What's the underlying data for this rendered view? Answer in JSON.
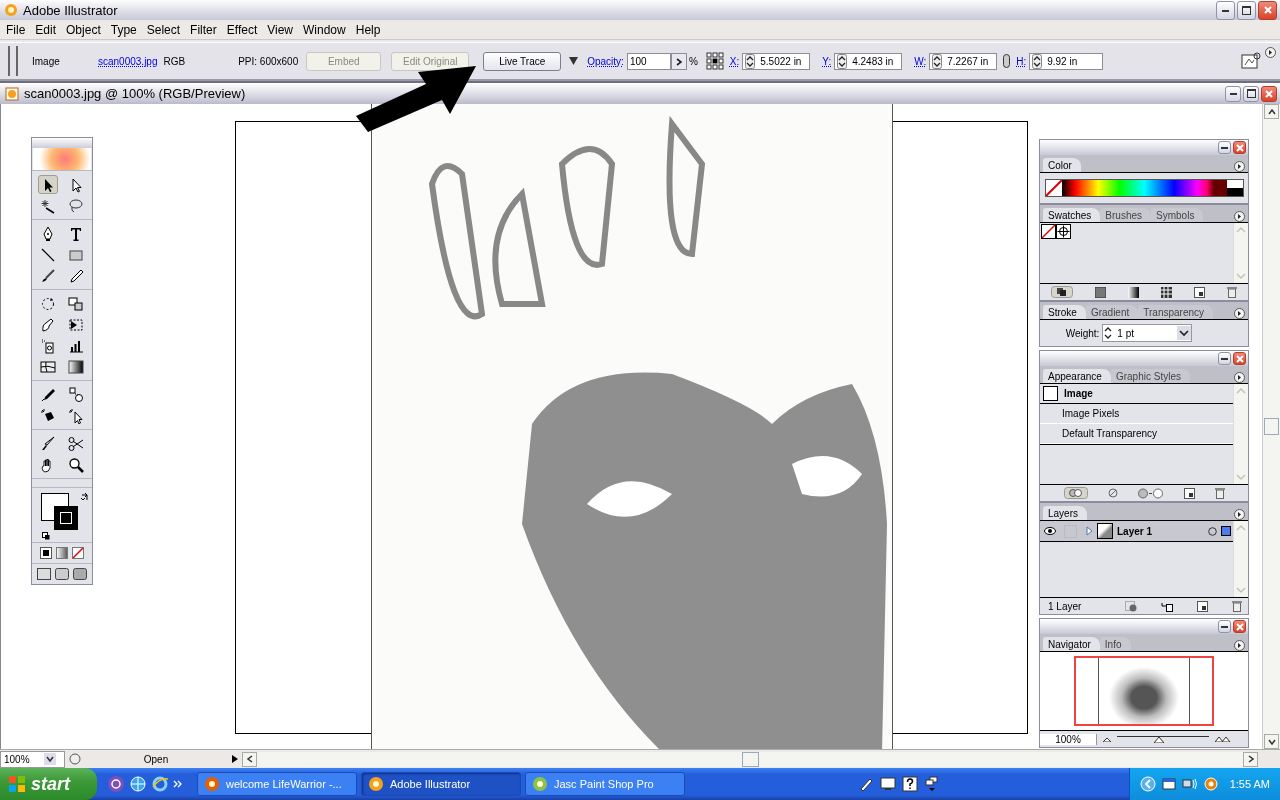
{
  "window": {
    "title": "Adobe Illustrator"
  },
  "menu": [
    "File",
    "Edit",
    "Object",
    "Type",
    "Select",
    "Filter",
    "Effect",
    "View",
    "Window",
    "Help"
  ],
  "control_bar": {
    "object_type": "Image",
    "file_link": "scan0003.jpg",
    "color_mode": "RGB",
    "ppi": "PPI: 600x600",
    "buttons": [
      {
        "label": "Embed",
        "disabled": true
      },
      {
        "label": "Edit Original",
        "disabled": true
      },
      {
        "label": "Live Trace",
        "disabled": false
      }
    ],
    "opacity_label": "Opacity:",
    "opacity": "100",
    "percent": "%",
    "fields": [
      {
        "label": "X:",
        "value": "5.5022 in"
      },
      {
        "label": "Y:",
        "value": "4.2483 in"
      },
      {
        "label": "W:",
        "value": "7.2267 in"
      },
      {
        "label": "H:",
        "value": "9.92 in"
      }
    ]
  },
  "document": {
    "title": "scan0003.jpg @ 100% (RGB/Preview)"
  },
  "toolbox": {
    "tools": [
      {
        "selected": true
      },
      {
        "selected": false
      },
      {
        "selected": false
      },
      {
        "selected": false
      },
      {
        "selected": false
      },
      {
        "selected": false
      },
      {
        "selected": false
      },
      {
        "selected": false
      },
      {
        "selected": false
      },
      {
        "selected": false
      },
      {
        "selected": false
      },
      {
        "selected": false
      },
      {
        "selected": false
      },
      {
        "selected": false
      },
      {
        "selected": false
      },
      {
        "selected": false
      },
      {
        "selected": false
      },
      {
        "selected": false
      },
      {
        "selected": false
      },
      {
        "selected": false
      },
      {
        "selected": false
      },
      {
        "selected": false
      },
      {
        "selected": false
      },
      {
        "selected": false
      },
      {
        "selected": false
      },
      {
        "selected": false
      }
    ]
  },
  "color_panel": {
    "tabs": [
      {
        "label": "Color",
        "selected": true
      }
    ]
  },
  "swatches_panel": {
    "tabs": [
      {
        "label": "Swatches",
        "selected": true
      },
      {
        "label": "Brushes",
        "selected": false
      },
      {
        "label": "Symbols",
        "selected": false
      }
    ]
  },
  "stroke_panel": {
    "tabs": [
      {
        "label": "Stroke",
        "selected": true
      },
      {
        "label": "Gradient",
        "selected": false
      },
      {
        "label": "Transparency",
        "selected": false
      }
    ],
    "weight_label": "Weight:",
    "weight": "1 pt"
  },
  "appearance_panel": {
    "tabs": [
      {
        "label": "Appearance",
        "selected": true
      },
      {
        "label": "Graphic Styles",
        "selected": false
      }
    ],
    "rows": [
      {
        "label": "Image",
        "kind": "header"
      },
      {
        "label": "Image Pixels",
        "kind": "item"
      },
      {
        "label": "Default Transparency",
        "kind": "item"
      }
    ]
  },
  "layers_panel": {
    "tabs": [
      {
        "label": "Layers",
        "selected": true
      }
    ],
    "layers": [
      {
        "name": "Layer 1",
        "visible": true,
        "selected": true
      }
    ],
    "footer": "1 Layer"
  },
  "navigator_panel": {
    "tabs": [
      {
        "label": "Navigator",
        "selected": true
      },
      {
        "label": "Info",
        "selected": false
      }
    ],
    "zoom": "100%",
    "zoom_slider": {
      "level": 0.45
    }
  },
  "status_bar": {
    "zoom": "100%",
    "info": "Open"
  },
  "taskbar": {
    "start": "start",
    "tasks": [
      {
        "label": "welcome LifeWarrior -...",
        "selected": false
      },
      {
        "label": "Adobe Illustrator",
        "selected": true
      },
      {
        "label": "Jasc Paint Shop Pro",
        "selected": false
      }
    ],
    "clock": "1:55 AM"
  }
}
